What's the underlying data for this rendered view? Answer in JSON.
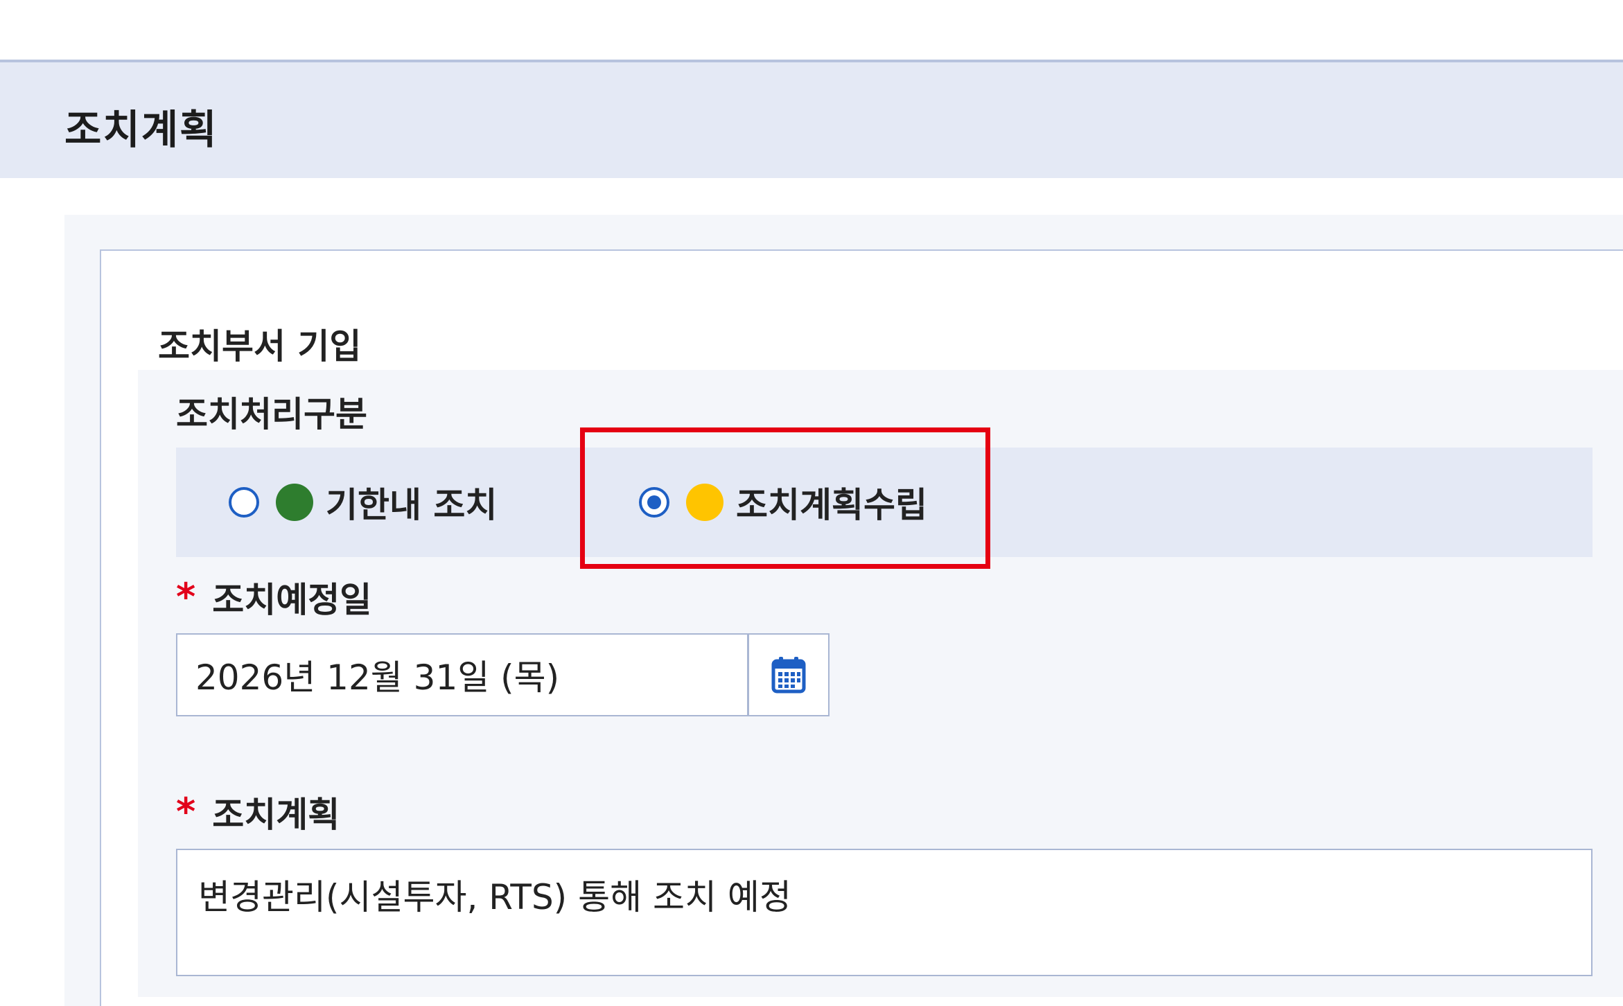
{
  "section": {
    "title": "조치계획"
  },
  "card": {
    "title": "조치부서 기입"
  },
  "colors": {
    "accent": "#1e5fc4",
    "required": "#e2001a",
    "highlight": "#e50012",
    "status_green": "#2e7d2e",
    "status_yellow": "#ffc400"
  },
  "action_type": {
    "label": "조치처리구분",
    "options": [
      {
        "label": "기한내 조치",
        "selected": false,
        "status_color": "green",
        "icon": "green-status-dot"
      },
      {
        "label": "조치계획수립",
        "selected": true,
        "status_color": "yellow",
        "icon": "yellow-status-dot"
      }
    ]
  },
  "scheduled_date": {
    "required_mark": "*",
    "label": "조치예정일",
    "value": "2026년 12월 31일 (목)",
    "button_icon": "calendar-icon"
  },
  "action_plan": {
    "required_mark": "*",
    "label": "조치계획",
    "value": "변경관리(시설투자, RTS) 통해 조치 예정"
  }
}
